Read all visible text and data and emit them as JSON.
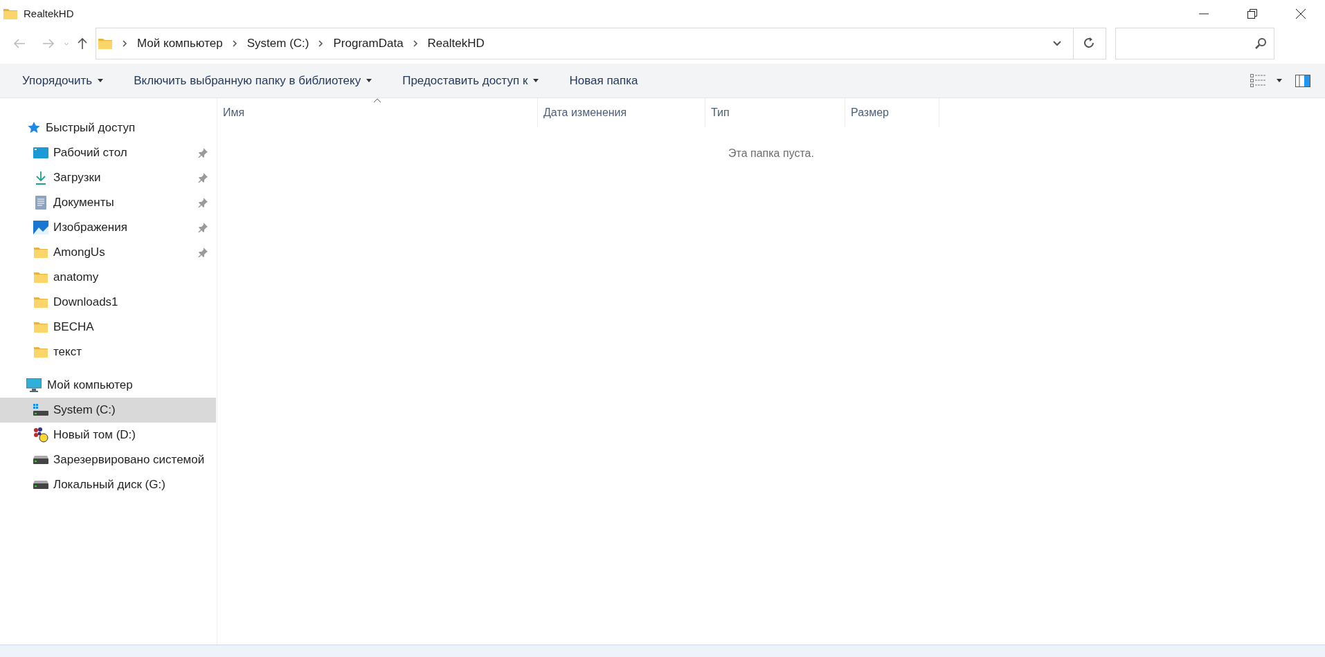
{
  "window": {
    "title": "RealtekHD"
  },
  "address_bar": {
    "breadcrumbs": [
      "Мой компьютер",
      "System (C:)",
      "ProgramData",
      "RealtekHD"
    ]
  },
  "toolbar": {
    "items": [
      {
        "label": "Упорядочить",
        "dropdown": true
      },
      {
        "label": "Включить выбранную папку в библиотеку",
        "dropdown": true
      },
      {
        "label": "Предоставить доступ к",
        "dropdown": true
      },
      {
        "label": "Новая папка",
        "dropdown": false
      }
    ]
  },
  "sidebar": {
    "groups": [
      {
        "label": "Быстрый доступ",
        "kind": "star",
        "children": [
          {
            "label": "Рабочий стол",
            "kind": "desktop",
            "pinned": true,
            "selected": false
          },
          {
            "label": "Загрузки",
            "kind": "download",
            "pinned": true,
            "selected": false
          },
          {
            "label": "Документы",
            "kind": "document",
            "pinned": true,
            "selected": false
          },
          {
            "label": "Изображения",
            "kind": "pictures",
            "pinned": true,
            "selected": false
          },
          {
            "label": "AmongUs",
            "kind": "folder",
            "pinned": true,
            "selected": false
          },
          {
            "label": "anatomy",
            "kind": "folder",
            "pinned": false,
            "selected": false
          },
          {
            "label": "Downloads1",
            "kind": "folder",
            "pinned": false,
            "selected": false
          },
          {
            "label": "BECHA",
            "kind": "folder",
            "pinned": false,
            "selected": false
          },
          {
            "label": "текст",
            "kind": "folder",
            "pinned": false,
            "selected": false
          }
        ]
      },
      {
        "label": "Мой компьютер",
        "kind": "computer",
        "children": [
          {
            "label": "System (C:)",
            "kind": "system-drive",
            "pinned": false,
            "selected": true
          },
          {
            "label": "Новый том (D:)",
            "kind": "custom-drive",
            "pinned": false,
            "selected": false
          },
          {
            "label": "Зарезервировано системой",
            "kind": "drive",
            "pinned": false,
            "selected": false
          },
          {
            "label": "Локальный диск (G:)",
            "kind": "drive",
            "pinned": false,
            "selected": false
          }
        ]
      }
    ]
  },
  "file_list": {
    "columns": [
      {
        "label": "Имя",
        "sorted": true
      },
      {
        "label": "Дата изменения",
        "sorted": false
      },
      {
        "label": "Тип",
        "sorted": false
      },
      {
        "label": "Размер",
        "sorted": false
      }
    ],
    "empty_message": "Эта папка пуста."
  }
}
